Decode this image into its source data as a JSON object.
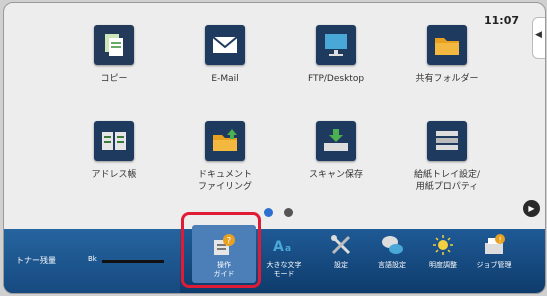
{
  "status": {
    "time": "11:07"
  },
  "home_icons": [
    {
      "label": "コピー",
      "icon": "copy-icon"
    },
    {
      "label": "E-Mail",
      "icon": "email-icon"
    },
    {
      "label": "FTP/Desktop",
      "icon": "desktop-icon"
    },
    {
      "label": "共有フォルダー",
      "icon": "shared-folder-icon"
    },
    {
      "label": "アドレス帳",
      "icon": "address-book-icon"
    },
    {
      "label": "ドキュメント",
      "label2": "ファイリング",
      "icon": "document-filing-icon"
    },
    {
      "label": "スキャン保存",
      "icon": "scan-save-icon"
    },
    {
      "label": "給紙トレイ設定/",
      "label2": "用紙プロパティ",
      "icon": "paper-tray-icon"
    }
  ],
  "pagination": {
    "current_page": 1,
    "total_pages": 2
  },
  "toner": {
    "label": "トナー残量",
    "color_label": "Bk"
  },
  "bottom_bar": [
    {
      "label": "操作",
      "label2": "ガイド",
      "icon": "operation-guide-icon"
    },
    {
      "label": "大きな文字",
      "label2": "モード",
      "icon": "large-text-icon"
    },
    {
      "label": "設定",
      "icon": "settings-icon"
    },
    {
      "label": "言語設定",
      "icon": "language-icon"
    },
    {
      "label": "明度調整",
      "icon": "brightness-icon"
    },
    {
      "label": "ジョブ管理",
      "icon": "job-status-icon"
    }
  ],
  "colors": {
    "accent_blue": "#0e3c6c",
    "highlight_red": "#e01b36",
    "folder_orange": "#e8a020"
  }
}
